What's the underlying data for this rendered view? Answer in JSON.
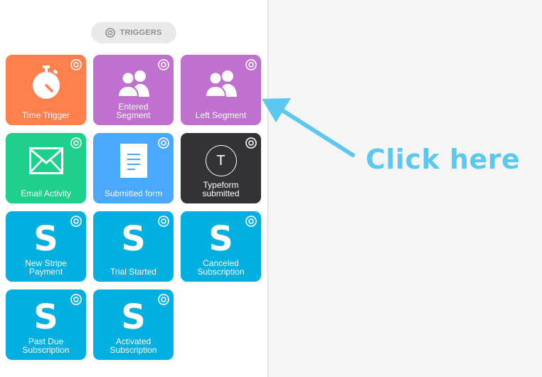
{
  "sidebar": {
    "header": {
      "label": "TRIGGERS",
      "icon": "target-icon"
    },
    "tiles": [
      {
        "label": "Time Trigger",
        "color": "#ff7f4d",
        "icon": "stopwatch-icon"
      },
      {
        "label": "Entered\nSegment",
        "color": "#c071cf",
        "icon": "users-icon"
      },
      {
        "label": "Left Segment",
        "color": "#c071cf",
        "icon": "users-icon"
      },
      {
        "label": "Email Activity",
        "color": "#1fcf8c",
        "icon": "envelope-icon"
      },
      {
        "label": "Submitted form",
        "color": "#4aa8ff",
        "icon": "document-icon"
      },
      {
        "label": "Typeform\nsubmitted",
        "color": "#333337",
        "icon": "typeform-icon",
        "glyph": "T"
      },
      {
        "label": "New Stripe\nPayment",
        "color": "#02afe1",
        "icon": "stripe-icon",
        "glyph": "S"
      },
      {
        "label": "Trial Started",
        "color": "#02afe1",
        "icon": "stripe-icon",
        "glyph": "S"
      },
      {
        "label": "Canceled\nSubscription",
        "color": "#02afe1",
        "icon": "stripe-icon",
        "glyph": "S"
      },
      {
        "label": "Past Due\nSubscription",
        "color": "#02afe1",
        "icon": "stripe-icon",
        "glyph": "S"
      },
      {
        "label": "Activated\nSubscription",
        "color": "#02afe1",
        "icon": "stripe-icon",
        "glyph": "S"
      }
    ]
  },
  "annotation": {
    "text": "Click here",
    "color": "#5bc8ef"
  }
}
